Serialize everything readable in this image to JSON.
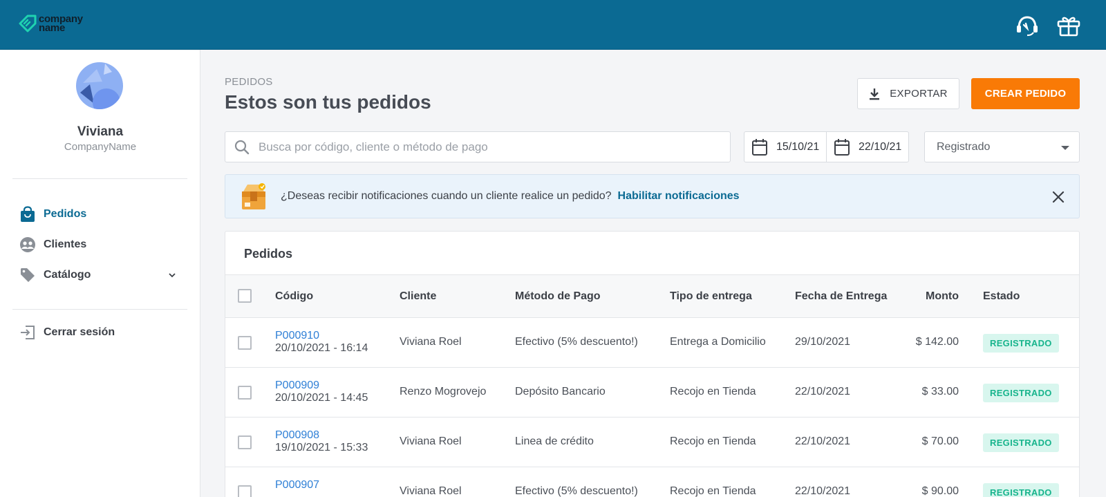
{
  "header": {
    "logo_line1": "company",
    "logo_line2": "name",
    "icons": [
      "support-icon",
      "gift-icon"
    ]
  },
  "sidebar": {
    "user_name": "Viviana",
    "company": "CompanyName",
    "items": [
      {
        "label": "Pedidos",
        "icon": "shopping-bag-icon",
        "active": true
      },
      {
        "label": "Clientes",
        "icon": "users-icon",
        "active": false
      },
      {
        "label": "Catálogo",
        "icon": "tag-icon",
        "active": false
      }
    ],
    "logout": "Cerrar sesión"
  },
  "main": {
    "overline": "PEDIDOS",
    "title": "Estos son tus pedidos",
    "export_label": "EXPORTAR",
    "create_label": "CREAR PEDIDO",
    "search_placeholder": "Busca por código, cliente o método de pago",
    "date_from": "15/10/21",
    "date_to": "22/10/21",
    "status_filter": "Registrado"
  },
  "notice": {
    "message": "¿Deseas recibir notificaciones cuando un cliente realice un pedido?",
    "link": "Habilitar notificaciones"
  },
  "table": {
    "title": "Pedidos",
    "columns": [
      "Código",
      "Cliente",
      "Método de Pago",
      "Tipo de entrega",
      "Fecha de Entrega",
      "Monto",
      "Estado"
    ],
    "rows": [
      {
        "code": "P000910",
        "datetime": "20/10/2021 - 16:14",
        "client": "Viviana Roel",
        "payment": "Efectivo (5% descuento!)",
        "delivery": "Entrega a Domicilio",
        "date": "29/10/2021",
        "amount": "$ 142.00",
        "status": "REGISTRADO"
      },
      {
        "code": "P000909",
        "datetime": "20/10/2021 - 14:45",
        "client": "Renzo Mogrovejo",
        "payment": "Depósito Bancario",
        "delivery": "Recojo en Tienda",
        "date": "22/10/2021",
        "amount": "$ 33.00",
        "status": "REGISTRADO"
      },
      {
        "code": "P000908",
        "datetime": "19/10/2021 - 15:33",
        "client": "Viviana Roel",
        "payment": "Linea de crédito",
        "delivery": "Recojo en Tienda",
        "date": "22/10/2021",
        "amount": "$ 70.00",
        "status": "REGISTRADO"
      },
      {
        "code": "P000907",
        "datetime": "",
        "client": "Viviana Roel",
        "payment": "Efectivo (5% descuento!)",
        "delivery": "Recojo en Tienda",
        "date": "22/10/2021",
        "amount": "$ 90.00",
        "status": "REGISTRADO"
      }
    ]
  },
  "colors": {
    "header_bg": "#0b6a93",
    "accent": "#f97a06",
    "link": "#2e7fd6",
    "badge_bg": "#d8f6ee",
    "badge_text": "#17b48c"
  }
}
